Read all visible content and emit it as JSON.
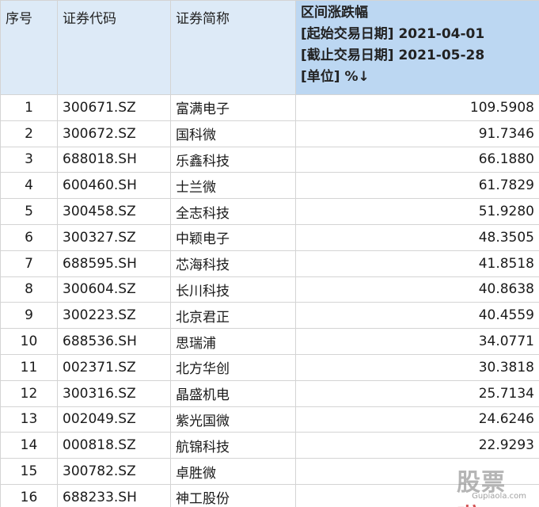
{
  "table": {
    "headers": {
      "seq": "序号",
      "code": "证券代码",
      "name": "证券简称",
      "value_lines": [
        "区间涨跌幅",
        "[起始交易日期] 2021-04-01",
        "[截止交易日期] 2021-05-28",
        "[单位] %↓"
      ]
    },
    "rows": [
      {
        "seq": "1",
        "code": "300671.SZ",
        "name": "富满电子",
        "value": "109.5908"
      },
      {
        "seq": "2",
        "code": "300672.SZ",
        "name": "国科微",
        "value": "91.7346"
      },
      {
        "seq": "3",
        "code": "688018.SH",
        "name": "乐鑫科技",
        "value": "66.1880"
      },
      {
        "seq": "4",
        "code": "600460.SH",
        "name": "士兰微",
        "value": "61.7829"
      },
      {
        "seq": "5",
        "code": "300458.SZ",
        "name": "全志科技",
        "value": "51.9280"
      },
      {
        "seq": "6",
        "code": "300327.SZ",
        "name": "中颖电子",
        "value": "48.3505"
      },
      {
        "seq": "7",
        "code": "688595.SH",
        "name": "芯海科技",
        "value": "41.8518"
      },
      {
        "seq": "8",
        "code": "300604.SZ",
        "name": "长川科技",
        "value": "40.8638"
      },
      {
        "seq": "9",
        "code": "300223.SZ",
        "name": "北京君正",
        "value": "40.4559"
      },
      {
        "seq": "10",
        "code": "688536.SH",
        "name": "思瑞浦",
        "value": "34.0771"
      },
      {
        "seq": "11",
        "code": "002371.SZ",
        "name": "北方华创",
        "value": "30.3818"
      },
      {
        "seq": "12",
        "code": "300316.SZ",
        "name": "晶盛机电",
        "value": "25.7134"
      },
      {
        "seq": "13",
        "code": "002049.SZ",
        "name": "紫光国微",
        "value": "24.6246"
      },
      {
        "seq": "14",
        "code": "000818.SZ",
        "name": "航锦科技",
        "value": "22.9293"
      },
      {
        "seq": "15",
        "code": "300782.SZ",
        "name": "卓胜微",
        "value": ""
      },
      {
        "seq": "16",
        "code": "688233.SH",
        "name": "神工股份",
        "value": ""
      }
    ]
  },
  "watermark": {
    "main_part1": "股票",
    "main_part2": "啦",
    "url": "Gupiaola.com"
  },
  "colors": {
    "header_bg": "#ddeaf7",
    "value_header_bg": "#bcd7f2",
    "grid_line": "#d4d4d4"
  }
}
